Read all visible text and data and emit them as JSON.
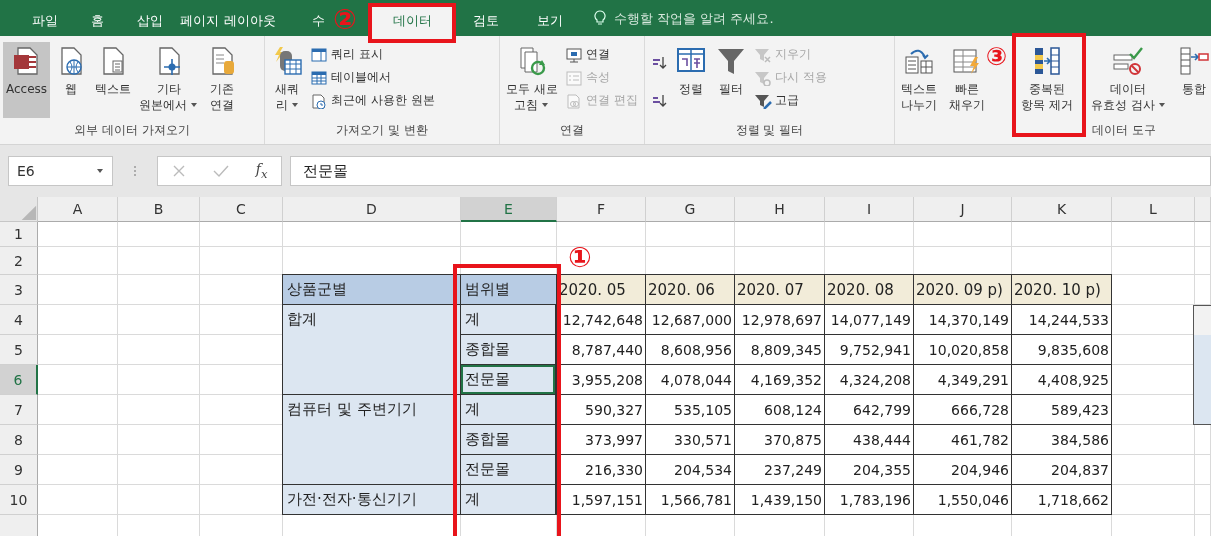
{
  "tabs": [
    {
      "label": "파일",
      "selected": false
    },
    {
      "label": "홈",
      "selected": false
    },
    {
      "label": "삽입",
      "selected": false
    },
    {
      "label": "페이지 레이아웃",
      "selected": false
    },
    {
      "label": "수",
      "selected": false
    },
    {
      "label": "데이터",
      "selected": true
    },
    {
      "label": "검토",
      "selected": false
    },
    {
      "label": "보기",
      "selected": false
    }
  ],
  "tell_me": {
    "placeholder": "수행할 작업을 알려 주세요."
  },
  "ribbon": {
    "groups": [
      {
        "label": "외부 데이터 가져오기",
        "items": [
          {
            "kind": "large",
            "lines": [
              "Access"
            ],
            "dropdown": false,
            "selected": true
          },
          {
            "kind": "large",
            "lines": [
              "웹"
            ],
            "dropdown": false,
            "selected": false
          },
          {
            "kind": "large",
            "lines": [
              "텍스트"
            ],
            "dropdown": false,
            "selected": false
          },
          {
            "kind": "large",
            "lines": [
              "기타",
              "원본에서"
            ],
            "dropdown": true,
            "selected": false
          },
          {
            "kind": "large",
            "lines": [
              "기존",
              "연결"
            ],
            "dropdown": false,
            "selected": false
          }
        ]
      },
      {
        "label": "가져오기 및 변환",
        "items": [
          {
            "kind": "large",
            "lines": [
              "새쿼",
              "리"
            ],
            "dropdown": true,
            "selected": false
          },
          {
            "kind": "stack",
            "items": [
              {
                "label": "쿼리 표시",
                "disabled": false
              },
              {
                "label": "테이블에서",
                "disabled": false
              },
              {
                "label": "최근에 사용한 원본",
                "disabled": false
              }
            ]
          }
        ]
      },
      {
        "label": "연결",
        "items": [
          {
            "kind": "large",
            "lines": [
              "모두 새로",
              "고침"
            ],
            "dropdown": true,
            "selected": false
          },
          {
            "kind": "stack",
            "items": [
              {
                "label": "연결",
                "disabled": false
              },
              {
                "label": "속성",
                "disabled": true
              },
              {
                "label": "연결 편집",
                "disabled": true
              }
            ]
          }
        ]
      },
      {
        "label": "정렬 및 필터",
        "items": [
          {
            "kind": "sort_icons"
          },
          {
            "kind": "large",
            "lines": [
              "정렬"
            ],
            "dropdown": false,
            "selected": false
          },
          {
            "kind": "large",
            "lines": [
              "필터"
            ],
            "dropdown": false,
            "selected": false
          },
          {
            "kind": "stack",
            "items": [
              {
                "label": "지우기",
                "disabled": true
              },
              {
                "label": "다시 적용",
                "disabled": true
              },
              {
                "label": "고급",
                "disabled": false
              }
            ]
          }
        ]
      },
      {
        "label": "데이터 도구",
        "items": [
          {
            "kind": "large",
            "lines": [
              "텍스트",
              "나누기"
            ],
            "dropdown": false,
            "selected": false
          },
          {
            "kind": "large",
            "lines": [
              "빠른",
              "채우기"
            ],
            "dropdown": false,
            "selected": false
          },
          {
            "kind": "large",
            "lines": [
              "중복된",
              "항목 제거"
            ],
            "dropdown": false,
            "selected": false
          },
          {
            "kind": "large",
            "lines": [
              "데이터",
              "유효성 검사"
            ],
            "dropdown": true,
            "selected": false
          },
          {
            "kind": "large",
            "lines": [
              "통합"
            ],
            "dropdown": false,
            "selected": false
          }
        ]
      }
    ]
  },
  "formula_bar": {
    "name_box": "E6",
    "function_label": "f$_{x}$",
    "formula": "전문몰"
  },
  "columns": [
    {
      "label": "A",
      "selected": false
    },
    {
      "label": "B",
      "selected": false
    },
    {
      "label": "C",
      "selected": false
    },
    {
      "label": "D",
      "selected": false
    },
    {
      "label": "E",
      "selected": true
    },
    {
      "label": "F",
      "selected": false
    },
    {
      "label": "G",
      "selected": false
    },
    {
      "label": "H",
      "selected": false
    },
    {
      "label": "I",
      "selected": false
    },
    {
      "label": "J",
      "selected": false
    },
    {
      "label": "K",
      "selected": false
    },
    {
      "label": "L",
      "selected": false
    }
  ],
  "rows": [
    {
      "label": "1",
      "selected": false
    },
    {
      "label": "2",
      "selected": false
    },
    {
      "label": "3",
      "selected": false
    },
    {
      "label": "4",
      "selected": false
    },
    {
      "label": "5",
      "selected": false
    },
    {
      "label": "6",
      "selected": true
    },
    {
      "label": "7",
      "selected": false
    },
    {
      "label": "8",
      "selected": false
    },
    {
      "label": "9",
      "selected": false
    },
    {
      "label": "10",
      "selected": false
    }
  ],
  "table": {
    "header": [
      "상품군별",
      "범위별",
      "2020. 05",
      "2020. 06",
      "2020. 07",
      "2020. 08",
      "2020. 09 p)",
      "2020. 10 p)"
    ],
    "groups": [
      {
        "name": "합계",
        "rows": [
          {
            "label": "계",
            "selected": false,
            "values": [
              "12,742,648",
              "12,687,000",
              "12,978,697",
              "14,077,149",
              "14,370,149",
              "14,244,533"
            ]
          },
          {
            "label": "종합몰",
            "selected": false,
            "values": [
              "8,787,440",
              "8,608,956",
              "8,809,345",
              "9,752,941",
              "10,020,858",
              "9,835,608"
            ]
          },
          {
            "label": "전문몰",
            "selected": true,
            "values": [
              "3,955,208",
              "4,078,044",
              "4,169,352",
              "4,324,208",
              "4,349,291",
              "4,408,925"
            ]
          }
        ]
      },
      {
        "name": "컴퓨터 및 주변기기",
        "rows": [
          {
            "label": "계",
            "selected": false,
            "values": [
              "590,327",
              "535,105",
              "608,124",
              "642,799",
              "666,728",
              "589,423"
            ]
          },
          {
            "label": "종합몰",
            "selected": false,
            "values": [
              "373,997",
              "330,571",
              "370,875",
              "438,444",
              "461,782",
              "384,586"
            ]
          },
          {
            "label": "전문몰",
            "selected": false,
            "values": [
              "216,330",
              "204,534",
              "237,249",
              "204,355",
              "204,946",
              "204,837"
            ]
          }
        ]
      },
      {
        "name": "가전·전자·통신기기",
        "rows": [
          {
            "label": "계",
            "selected": false,
            "values": [
              "1,597,151",
              "1,566,781",
              "1,439,150",
              "1,783,196",
              "1,550,046",
              "1,718,662"
            ]
          }
        ]
      }
    ]
  },
  "annotations": [
    {
      "label": "①"
    },
    {
      "label": "②"
    },
    {
      "label": "③"
    }
  ]
}
